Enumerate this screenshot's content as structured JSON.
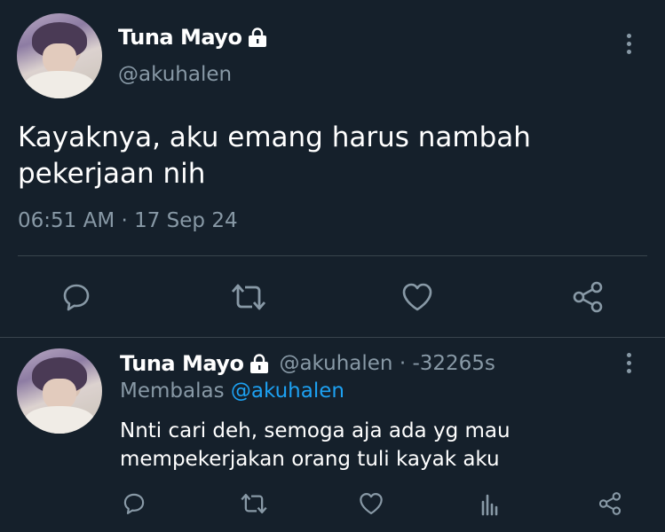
{
  "main_tweet": {
    "author_name": "Tuna Mayo",
    "handle": "@akuhalen",
    "text": "Kayaknya, aku emang harus nambah pekerjaan nih",
    "timestamp": "06:51 AM · 17 Sep 24",
    "actions": [
      "reply-icon",
      "retweet-icon",
      "like-icon",
      "share-icon"
    ]
  },
  "reply_tweet": {
    "author_name": "Tuna Mayo",
    "handle_time": "@akuhalen · -32265s",
    "replying_label": "Membalas",
    "replying_to": "@akuhalen",
    "text": "Nnti cari deh, semoga aja ada yg mau mempekerjakan orang tuli kayak aku",
    "actions": [
      "reply-icon",
      "retweet-icon",
      "like-icon",
      "analytics-icon",
      "share-icon"
    ]
  },
  "colors": {
    "background": "#15202b",
    "text_primary": "#ffffff",
    "text_secondary": "#8899a6",
    "link": "#1da1f2",
    "divider": "#38444d"
  }
}
